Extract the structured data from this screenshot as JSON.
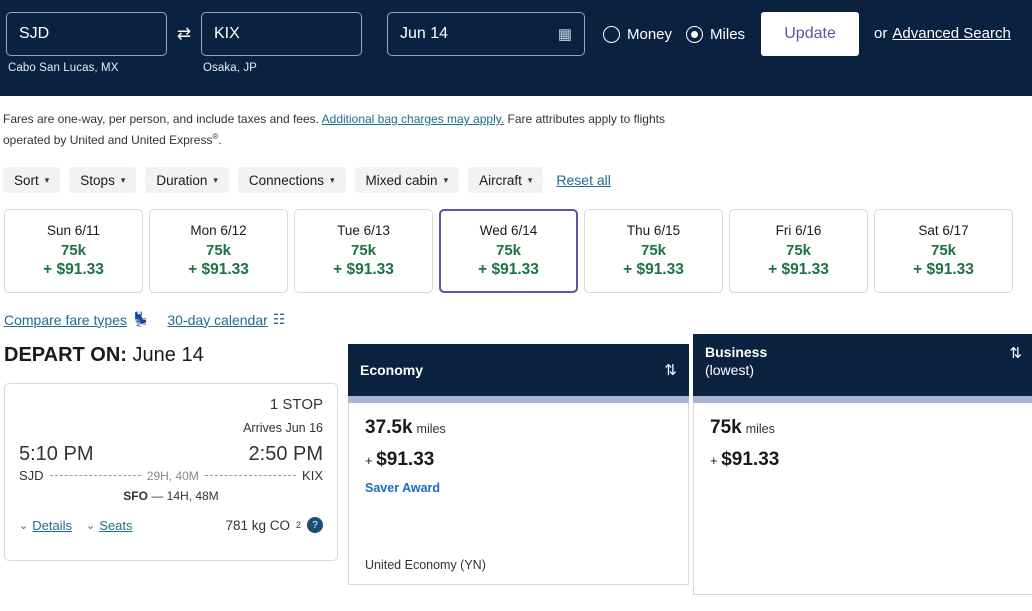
{
  "search": {
    "origin": {
      "code": "SJD",
      "city": "Cabo San Lucas, MX"
    },
    "destination": {
      "code": "KIX",
      "city": "Osaka, JP"
    },
    "date": "Jun 14",
    "swap_icon": "⇄",
    "calendar_icon": "▦",
    "money_label": "Money",
    "miles_label": "Miles",
    "update_label": "Update",
    "or_label": "or",
    "advanced_search_label": "Advanced Search"
  },
  "disclaimer": {
    "part1": "Fares are one-way, per person, and include taxes and fees. ",
    "link": "Additional bag charges may apply.",
    "part2": " Fare attributes apply to flights operated by United and United Express",
    "sup": "®",
    "end": "."
  },
  "filters": {
    "chips": [
      {
        "label": "Sort"
      },
      {
        "label": "Stops"
      },
      {
        "label": "Duration"
      },
      {
        "label": "Connections"
      },
      {
        "label": "Mixed cabin"
      },
      {
        "label": "Aircraft"
      }
    ],
    "reset_label": "Reset all",
    "chevron": "▾"
  },
  "date_strip": [
    {
      "day": "Sun 6/11",
      "miles": "75k",
      "price": "+ $91.33",
      "selected": false
    },
    {
      "day": "Mon 6/12",
      "miles": "75k",
      "price": "+ $91.33",
      "selected": false
    },
    {
      "day": "Tue 6/13",
      "miles": "75k",
      "price": "+ $91.33",
      "selected": false
    },
    {
      "day": "Wed 6/14",
      "miles": "75k",
      "price": "+ $91.33",
      "selected": true
    },
    {
      "day": "Thu 6/15",
      "miles": "75k",
      "price": "+ $91.33",
      "selected": false
    },
    {
      "day": "Fri 6/16",
      "miles": "75k",
      "price": "+ $91.33",
      "selected": false
    },
    {
      "day": "Sat 6/17",
      "miles": "75k",
      "price": "+ $91.33",
      "selected": false
    }
  ],
  "compare": {
    "fare_types_label": "Compare fare types",
    "seat_icon": "💺",
    "calendar_label": "30-day calendar",
    "calendar_icon": "☷"
  },
  "results": {
    "depart_prefix": "DEPART ON:",
    "depart_date": " June 14",
    "flight": {
      "stops": "1 STOP",
      "arrives": "Arrives Jun 16",
      "depart_time": "5:10 PM",
      "arrive_time": "2:50 PM",
      "origin_code": "SJD",
      "dest_code": "KIX",
      "duration": "29H, 40M",
      "layover_airport": "SFO",
      "layover_sep": "—",
      "layover_time": "14H, 48M",
      "details_label": "Details",
      "seats_label": "Seats",
      "chevron": "⌄",
      "co2": "781 kg CO",
      "co2_sub": "2",
      "help_icon": "?"
    },
    "fares": [
      {
        "name": "Economy",
        "sublabel": "",
        "sort_icon": "⇅",
        "miles": "37.5k",
        "miles_unit": "miles",
        "price_plus": "+ ",
        "price": "$91.33",
        "award": "Saver Award",
        "cabin": "United Economy (YN)"
      },
      {
        "name": "Business",
        "sublabel": "(lowest)",
        "sort_icon": "⇅",
        "miles": "75k",
        "miles_unit": "miles",
        "price_plus": "+ ",
        "price": "$91.33",
        "award": "",
        "cabin": ""
      }
    ]
  },
  "colors": {
    "header_bg": "#0a2240",
    "accent_purple": "#6b4ea8",
    "price_green": "#1e7145",
    "link_teal": "#1c6e8c"
  }
}
